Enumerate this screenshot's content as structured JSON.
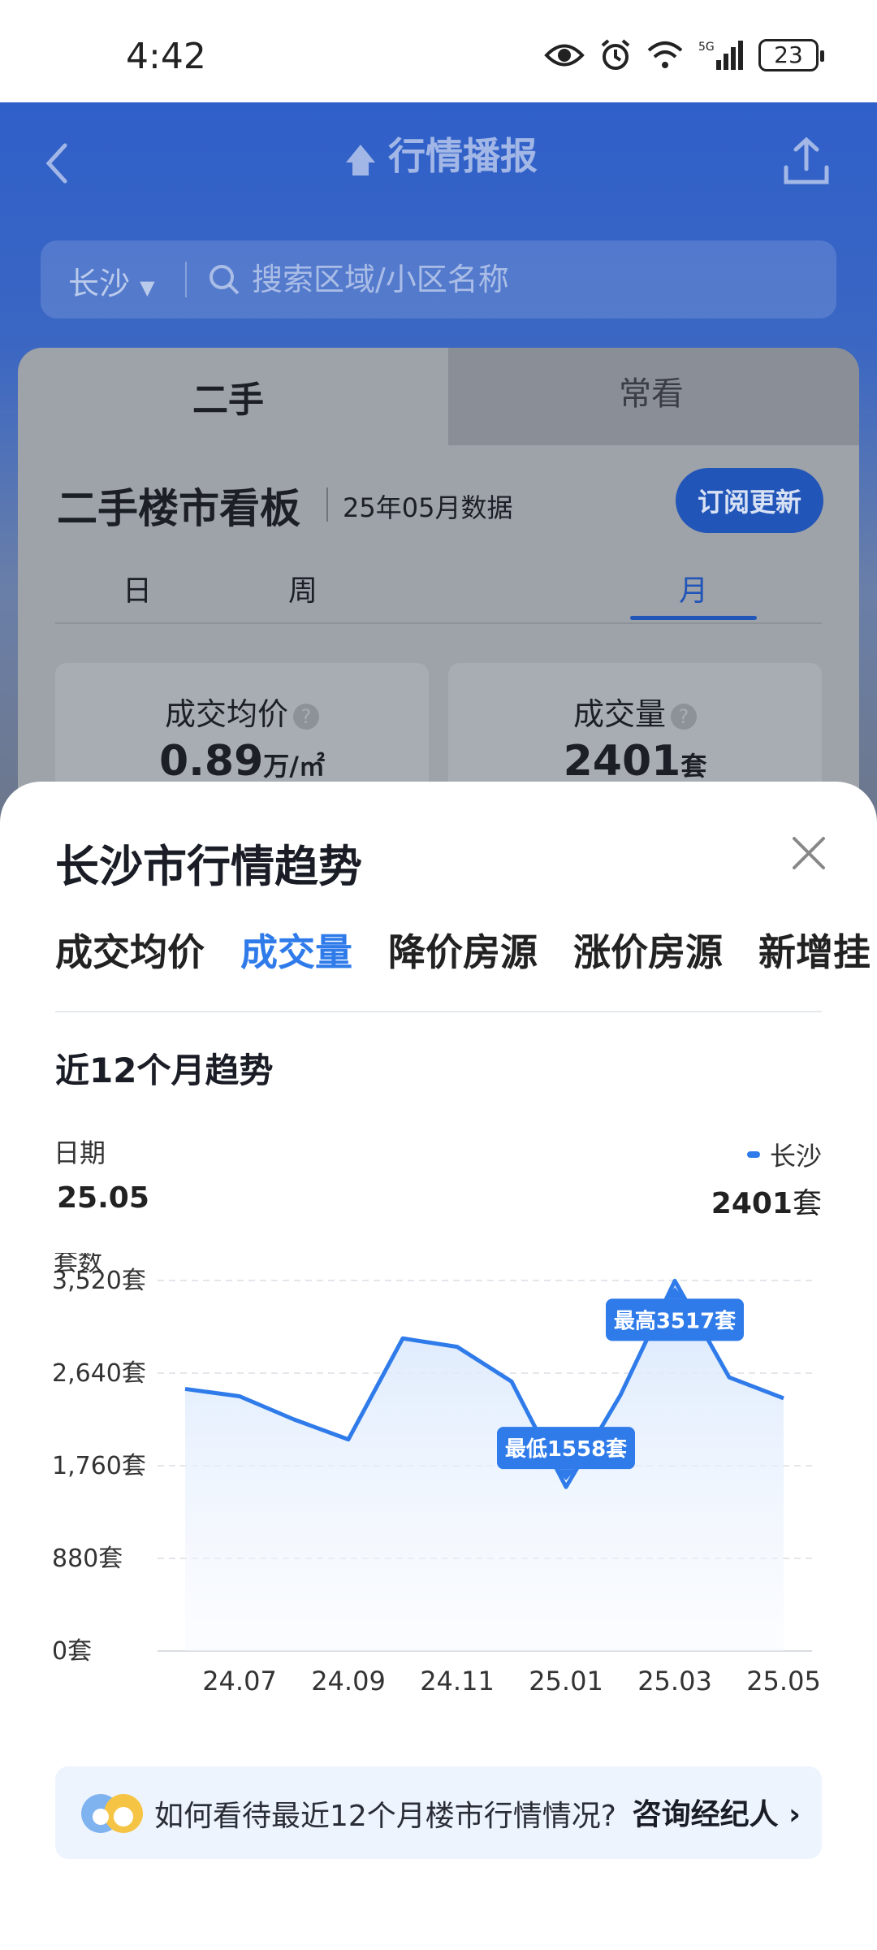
{
  "status_bar": {
    "time": "4:42",
    "network": "5G",
    "battery": "23"
  },
  "header": {
    "title": "行情播报"
  },
  "search": {
    "city": "长沙",
    "placeholder": "搜索区域/小区名称"
  },
  "board": {
    "tabs": [
      "二手",
      "常看"
    ],
    "title": "二手楼市看板",
    "data_month": "25年05月数据",
    "subscribe_label": "订阅更新",
    "periods": [
      "日",
      "周",
      "月"
    ],
    "active_period": "月",
    "stats": [
      {
        "label": "成交均价",
        "value": "0.89",
        "unit": "万/㎡"
      },
      {
        "label": "成交量",
        "value": "2401",
        "unit": "套"
      }
    ]
  },
  "sheet": {
    "title": "长沙市行情趋势",
    "metric_tabs": [
      "成交均价",
      "成交量",
      "降价房源",
      "涨价房源",
      "新增挂"
    ],
    "active_metric": "成交量",
    "trend_title": "近12个月趋势",
    "date_label": "日期",
    "date_value": "25.05",
    "legend": "长沙",
    "current_value": "2401",
    "current_unit": "套",
    "consult_question": "如何看待最近12个月楼市行情情况?",
    "consult_link": "咨询经纪人"
  },
  "chart_data": {
    "type": "area",
    "ylabel": "套数",
    "y_ticks": [
      "3,520套",
      "2,640套",
      "1,760套",
      "880套",
      "0套"
    ],
    "y_tick_values": [
      3520,
      2640,
      1760,
      880,
      0
    ],
    "ylim": [
      0,
      3520
    ],
    "x_ticks": [
      "24.07",
      "24.09",
      "24.11",
      "25.01",
      "25.03",
      "25.05"
    ],
    "x": [
      "24.06",
      "24.07",
      "24.08",
      "24.09",
      "24.10",
      "24.11",
      "24.12",
      "25.01",
      "25.02",
      "25.03",
      "25.04",
      "25.05"
    ],
    "series": [
      {
        "name": "长沙",
        "values": [
          2490,
          2420,
          2200,
          2010,
          2970,
          2890,
          2560,
          1558,
          2430,
          3517,
          2600,
          2401
        ],
        "color": "#2f7bea"
      }
    ],
    "annotations": [
      {
        "x": "25.03",
        "text": "最高3517套"
      },
      {
        "x": "25.01",
        "text": "最低1558套"
      }
    ],
    "grid": true
  }
}
